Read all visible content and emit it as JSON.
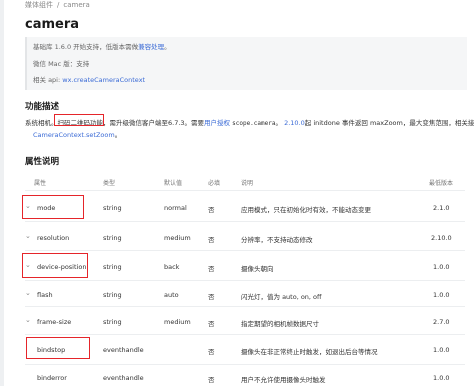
{
  "breadcrumb": {
    "parent": "媒体组件",
    "separator": "/",
    "current": "camera"
  },
  "title": "camera",
  "info": {
    "version_prefix": "基础库 1.6.0 开始支持，低版本需做",
    "version_link": "兼容处理",
    "version_suffix": "。",
    "mac": "微信 Mac 版：支持",
    "api_prefix": "相关 api:",
    "api_link": "wx.createCameraContext"
  },
  "section_description": {
    "heading": "功能描述",
    "line1": {
      "prefix": "系统相机。",
      "highlight": "扫码二维码功能",
      "mid": "，需升级微信客户端至6.7.3。需要",
      "link1": "用户授权",
      "code": "scope.camera",
      "mid2": "。",
      "version": "2.10.0",
      "suffix": "起 initdone 事件返回 maxZoom，最大变焦范围，相关接"
    },
    "line2_link": "CameraContext.setZoom",
    "line2_suffix": "。"
  },
  "section_props": {
    "heading": "属性说明",
    "columns": [
      "属性",
      "类型",
      "默认值",
      "必填",
      "说明",
      "最低版本"
    ],
    "rows": [
      {
        "name": "mode",
        "type": "string",
        "default": "normal",
        "required": "否",
        "desc": "应用模式，只在初始化时有效，不能动态变更",
        "version": "2.1.0",
        "expandable": true
      },
      {
        "name": "resolution",
        "type": "string",
        "default": "medium",
        "required": "否",
        "desc": "分辨率，不支持动态修改",
        "version": "2.10.0",
        "expandable": true
      },
      {
        "name": "device-position",
        "type": "string",
        "default": "back",
        "required": "否",
        "desc": "摄像头朝向",
        "version": "1.0.0",
        "expandable": true
      },
      {
        "name": "flash",
        "type": "string",
        "default": "auto",
        "required": "否",
        "desc": "闪光灯，值为 auto, on, off",
        "version": "1.0.0",
        "expandable": true
      },
      {
        "name": "frame-size",
        "type": "string",
        "default": "medium",
        "required": "否",
        "desc": "指定期望的相机帧数据尺寸",
        "version": "2.7.0",
        "expandable": true
      },
      {
        "name": "bindstop",
        "type": "eventhandle",
        "default": "",
        "required": "否",
        "desc": "摄像头在非正常终止时触发，如退出后台等情况",
        "version": "1.0.0",
        "expandable": false
      },
      {
        "name": "binderror",
        "type": "eventhandle",
        "default": "",
        "required": "否",
        "desc": "用户不允许使用摄像头时触发",
        "version": "1.0.0",
        "expandable": false
      }
    ]
  },
  "colors": {
    "link": "#3b6bd6",
    "highlight_box": "#e5252a"
  }
}
